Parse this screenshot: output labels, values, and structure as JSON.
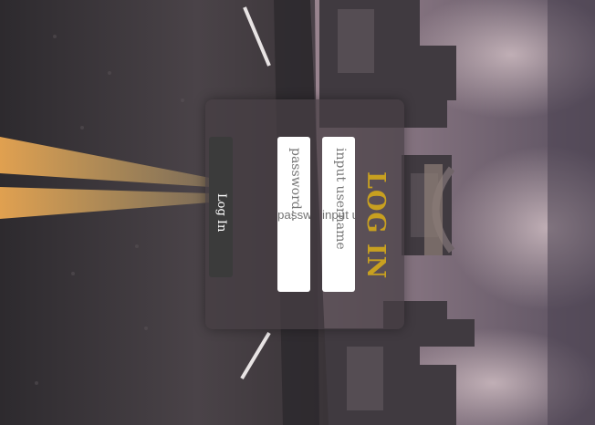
{
  "login": {
    "title": "LOG IN",
    "username_placeholder": "input username",
    "password_placeholder": "password...",
    "submit_label": "Log In"
  },
  "colors": {
    "title": "#c8a020",
    "card": "#463e44",
    "button": "#3b3b3b",
    "field": "#ffffff"
  }
}
